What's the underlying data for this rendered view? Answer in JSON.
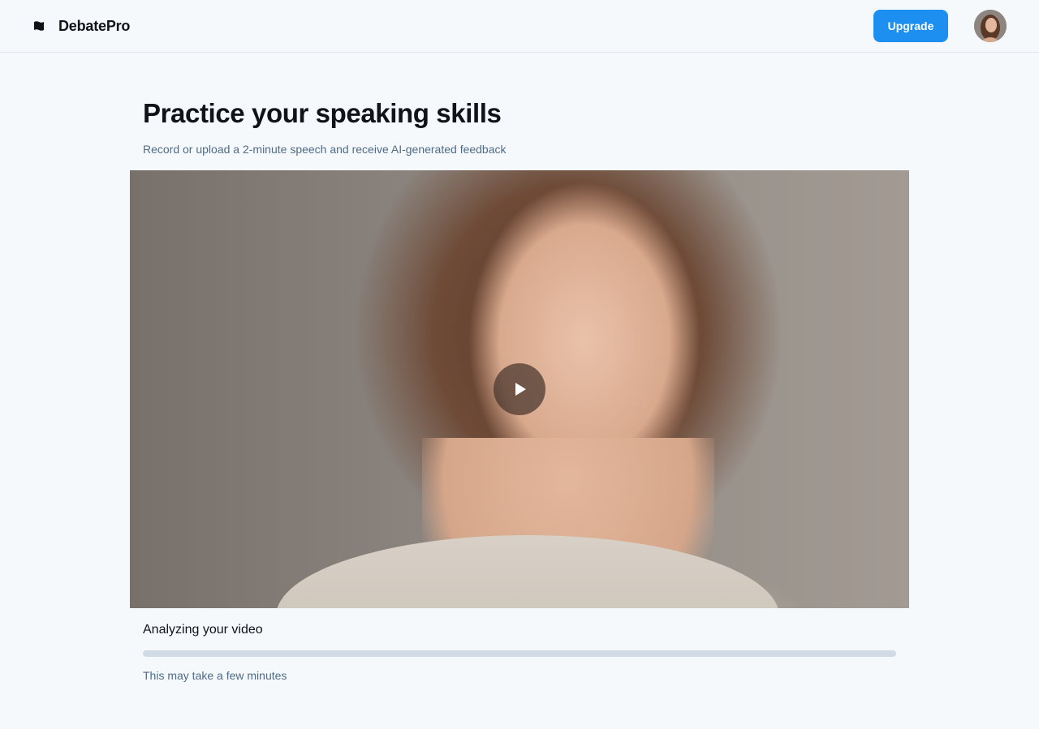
{
  "header": {
    "brand_name": "DebatePro",
    "brand_icon": "flag-icon",
    "upgrade_label": "Upgrade",
    "avatar_icon": "user-avatar"
  },
  "main": {
    "title": "Practice your speaking skills",
    "subtitle": "Record or upload a 2-minute speech and receive AI-generated feedback",
    "video": {
      "play_icon": "play-icon"
    },
    "analysis": {
      "label": "Analyzing your video",
      "progress_fraction": 0,
      "note": "This may take a few minutes"
    }
  },
  "colors": {
    "accent": "#1d8ff0",
    "background": "#f6f9fc",
    "muted_text": "#4e6b87",
    "progress_track": "#d0dbe5"
  }
}
